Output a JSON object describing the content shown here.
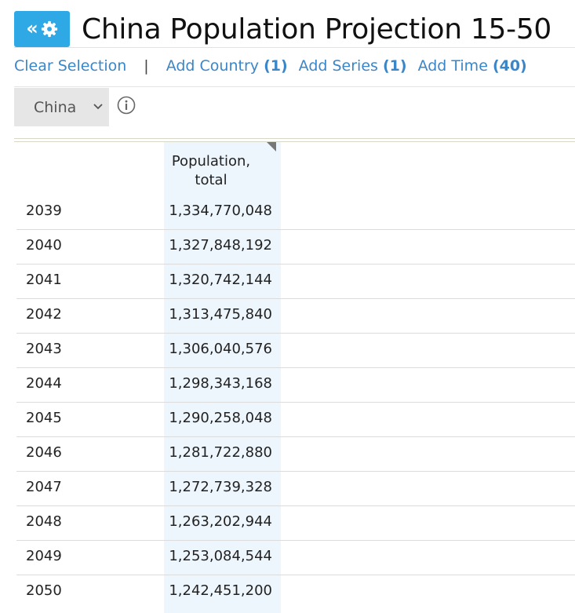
{
  "header": {
    "title": "China Population Projection 15-50",
    "toggle_chevron": "«",
    "toggle_icon": "gear-icon",
    "accent_color": "#2fa8e6"
  },
  "toolbar": {
    "clear_label": "Clear Selection",
    "separator": "|",
    "add_country_label": "Add Country",
    "add_country_count": "(1)",
    "add_series_label": "Add Series",
    "add_series_count": "(1)",
    "add_time_label": "Add Time",
    "add_time_count": "(40)",
    "link_color": "#3a86c8"
  },
  "filter": {
    "country_selected": "China",
    "info_icon": "info-icon"
  },
  "table": {
    "columns": [
      "Population, total"
    ],
    "column_header_line1": "Population,",
    "column_header_line2": "total",
    "rows": [
      {
        "year": "2039",
        "value": "1,334,770,048"
      },
      {
        "year": "2040",
        "value": "1,327,848,192"
      },
      {
        "year": "2041",
        "value": "1,320,742,144"
      },
      {
        "year": "2042",
        "value": "1,313,475,840"
      },
      {
        "year": "2043",
        "value": "1,306,040,576"
      },
      {
        "year": "2044",
        "value": "1,298,343,168"
      },
      {
        "year": "2045",
        "value": "1,290,258,048"
      },
      {
        "year": "2046",
        "value": "1,281,722,880"
      },
      {
        "year": "2047",
        "value": "1,272,739,328"
      },
      {
        "year": "2048",
        "value": "1,263,202,944"
      },
      {
        "year": "2049",
        "value": "1,253,084,544"
      },
      {
        "year": "2050",
        "value": "1,242,451,200"
      }
    ]
  }
}
